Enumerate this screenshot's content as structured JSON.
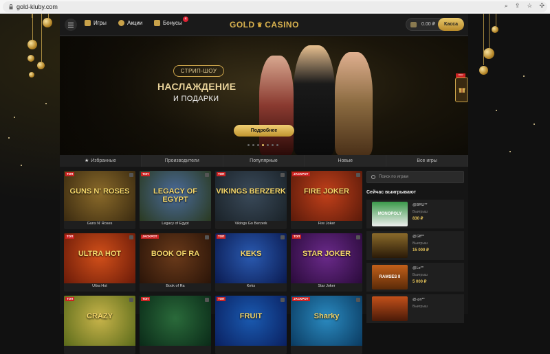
{
  "browser": {
    "url": "gold-kluby.com"
  },
  "header": {
    "nav": [
      {
        "label": "Игры"
      },
      {
        "label": "Акции"
      },
      {
        "label": "Бонусы"
      }
    ],
    "bonus_count": "4",
    "logo_left": "GOLD",
    "logo_right": "CASINO",
    "balance": "0.00 ₽",
    "kassa": "Касса"
  },
  "hero": {
    "badge": "СТРИП-ШОУ",
    "title": "НАСЛАЖДЕНИЕ",
    "subtitle": "И ПОДАРКИ",
    "button": "Подробнее",
    "gift_new": "NEW"
  },
  "tabs": [
    {
      "label": "Избранные"
    },
    {
      "label": "Производители"
    },
    {
      "label": "Популярные"
    },
    {
      "label": "Новые"
    },
    {
      "label": "Все игры"
    }
  ],
  "games": [
    {
      "title": "Guns N' Roses",
      "tag": "ТОП",
      "art": "GUNS N' ROSES",
      "colors": [
        "#8a6a2a",
        "#3a2a10"
      ]
    },
    {
      "title": "Legacy of Egypt",
      "tag": "ТОП",
      "art": "LEGACY OF EGYPT",
      "colors": [
        "#4a6a9a",
        "#2a3a20"
      ]
    },
    {
      "title": "Vikings Go Berzerk",
      "tag": "ТОП",
      "art": "VIKINGS BERZERK",
      "colors": [
        "#3a4a5a",
        "#1a2228"
      ]
    },
    {
      "title": "Fire Joker",
      "tag": "JACKPOT",
      "art": "FIRE JOKER",
      "colors": [
        "#c2401a",
        "#5a1a0a"
      ]
    },
    {
      "title": "Ultra Hot",
      "tag": "ТОП",
      "art": "ULTRA HOT",
      "colors": [
        "#d2501a",
        "#6a1a08"
      ]
    },
    {
      "title": "Book of Ra",
      "tag": "JACKPOT",
      "art": "BOOK OF RA",
      "colors": [
        "#6a3a1a",
        "#2a1408"
      ]
    },
    {
      "title": "Keks",
      "tag": "ТОП",
      "art": "KEKS",
      "colors": [
        "#2a5ab0",
        "#0a1a50"
      ]
    },
    {
      "title": "Star Joker",
      "tag": "ТОП",
      "art": "STAR JOKER",
      "colors": [
        "#6a2a8a",
        "#2a0a3a"
      ]
    },
    {
      "title": "",
      "tag": "ТОП",
      "art": "CRAZY",
      "colors": [
        "#c8b44a",
        "#5a6a1a"
      ]
    },
    {
      "title": "",
      "tag": "ТОП",
      "art": "",
      "colors": [
        "#2a6a3a",
        "#0a2a18"
      ]
    },
    {
      "title": "",
      "tag": "ТОП",
      "art": "FRUIT",
      "colors": [
        "#1a5ab0",
        "#0a2060"
      ]
    },
    {
      "title": "",
      "tag": "JACKPOT",
      "art": "Sharky",
      "colors": [
        "#2a8ac0",
        "#0a3a60"
      ]
    }
  ],
  "sidebar": {
    "search_placeholder": "Поиск по играм",
    "winners_title": "Сейчас выигрывают",
    "winners": [
      {
        "name": "@BRU**",
        "label": "Выигрыш",
        "amount": "830 ₽",
        "colors": [
          "#3a9a4a",
          "#eee"
        ],
        "art": "MONOPOLY"
      },
      {
        "name": "@Gff**",
        "label": "Выигрыш",
        "amount": "15 000 ₽",
        "colors": [
          "#8a6a2a",
          "#2a1a08"
        ],
        "art": ""
      },
      {
        "name": "@Le**",
        "label": "Выигрыш",
        "amount": "5 000 ₽",
        "colors": [
          "#c2601a",
          "#5a2a08"
        ],
        "art": "RAMSES II"
      },
      {
        "name": "@-pn**",
        "label": "Выигрыш",
        "amount": "",
        "colors": [
          "#c2501a",
          "#4a1a08"
        ],
        "art": ""
      }
    ]
  }
}
